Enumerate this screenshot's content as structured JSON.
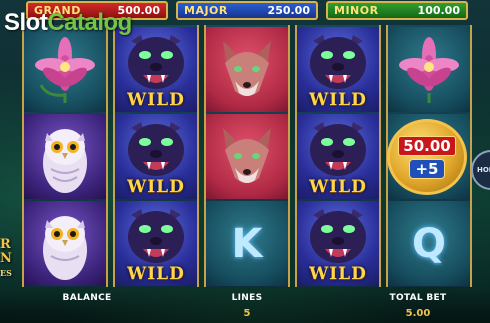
{
  "jackpots": {
    "grand": {
      "label": "GRAND",
      "value": "500.00"
    },
    "major": {
      "label": "MAJOR",
      "value": "250.00"
    },
    "minor": {
      "label": "MINOR",
      "value": "100.00"
    }
  },
  "watermark": {
    "part1": "Slot",
    "part2": "Catalog"
  },
  "side_title": {
    "line1": "R",
    "line2": "N",
    "line3": "ES"
  },
  "reels": [
    [
      "lily-flower",
      "owl",
      "owl"
    ],
    [
      "panther-wild",
      "panther-wild",
      "panther-wild"
    ],
    [
      "fox",
      "fox",
      "letter-K"
    ],
    [
      "panther-wild",
      "panther-wild",
      "panther-wild"
    ],
    [
      "lily-flower",
      "bonus-coin",
      "letter-Q"
    ]
  ],
  "symbols": {
    "wild_label": "WILD",
    "letter_k": "K",
    "letter_q": "Q"
  },
  "bonus_coin": {
    "value": "50.00",
    "extra": "+5"
  },
  "hold_button": {
    "label": "HOLD"
  },
  "bottom_bar": {
    "balance_label": "BALANCE",
    "balance_value": "",
    "lines_label": "LINES",
    "lines_value": "5",
    "bet_label": "TOTAL BET",
    "bet_value": "5.00"
  },
  "colors": {
    "reel_frame": "#c7a24a",
    "wild_text": "#ffd54a",
    "grand_bg": "#d22a2a",
    "major_bg": "#2b5fd4",
    "minor_bg": "#2fa02f"
  }
}
